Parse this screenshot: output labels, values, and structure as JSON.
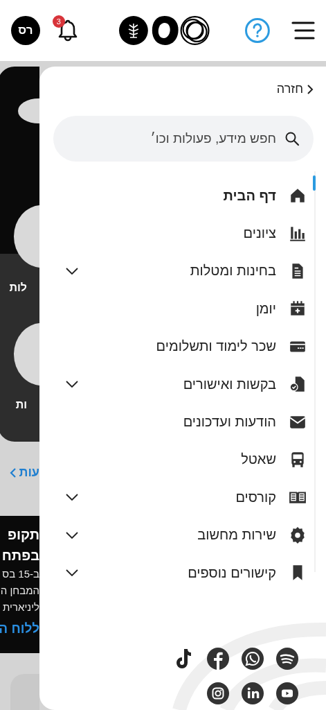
{
  "header": {
    "avatar_initials": "רס",
    "notification_count": "3"
  },
  "background_page": {
    "card_labels": [
      "לות",
      "ות"
    ],
    "link_label": "עות",
    "news": {
      "title_lines": [
        "תקופ",
        "בפתח"
      ],
      "body_lines": [
        "ב-15 בס",
        "המבחן ה",
        "ליניארית"
      ],
      "link": "ללוח ה"
    }
  },
  "drawer": {
    "back_label": "חזרה",
    "search": {
      "placeholder": "חפש מידע, פעולות וכו׳"
    },
    "items": [
      {
        "label": "דף הבית",
        "selected": true,
        "has_submenu": false
      },
      {
        "label": "ציונים",
        "selected": false,
        "has_submenu": false
      },
      {
        "label": "בחינות ומטלות",
        "selected": false,
        "has_submenu": true
      },
      {
        "label": "יומן",
        "selected": false,
        "has_submenu": false
      },
      {
        "label": "שכר לימוד ותשלומים",
        "selected": false,
        "has_submenu": false
      },
      {
        "label": "בקשות ואישורים",
        "selected": false,
        "has_submenu": true
      },
      {
        "label": "הודעות ועדכונים",
        "selected": false,
        "has_submenu": false
      },
      {
        "label": "שאטל",
        "selected": false,
        "has_submenu": false
      },
      {
        "label": "קורסים",
        "selected": false,
        "has_submenu": true
      },
      {
        "label": "שירות מחשוב",
        "selected": false,
        "has_submenu": true
      },
      {
        "label": "קישורים נוספים",
        "selected": false,
        "has_submenu": true
      }
    ]
  }
}
